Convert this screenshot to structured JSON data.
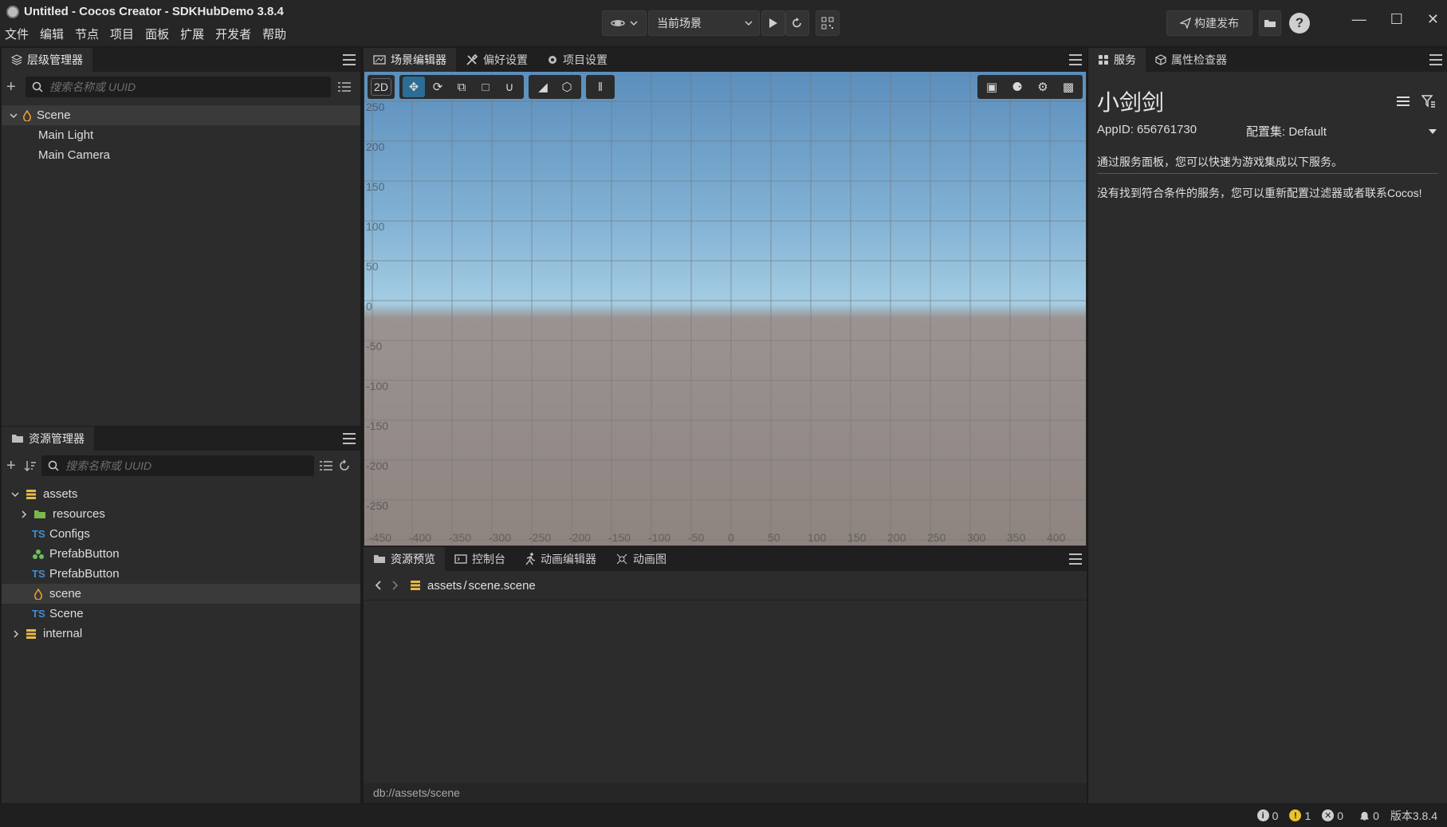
{
  "window": {
    "title": "Untitled - Cocos Creator - SDKHubDemo 3.8.4",
    "menus": [
      "文件",
      "编辑",
      "节点",
      "项目",
      "面板",
      "扩展",
      "开发者",
      "帮助"
    ],
    "scene_select": "当前场景",
    "build_label": "构建发布",
    "help_label": "?"
  },
  "hierarchy": {
    "tab": "层级管理器",
    "search_placeholder": "搜索名称或 UUID",
    "nodes": [
      "Scene",
      "Main Light",
      "Main Camera"
    ]
  },
  "assets": {
    "tab": "资源管理器",
    "search_placeholder": "搜索名称或 UUID",
    "items": [
      {
        "label": "assets",
        "icon": "db-icon"
      },
      {
        "label": "resources",
        "icon": "folder-icon"
      },
      {
        "label": "Configs",
        "icon": "TS"
      },
      {
        "label": "PrefabButton",
        "icon": "prefab-icon"
      },
      {
        "label": "PrefabButton",
        "icon": "TS"
      },
      {
        "label": "scene",
        "icon": "scene-icon"
      },
      {
        "label": "Scene",
        "icon": "TS"
      },
      {
        "label": "internal",
        "icon": "db-icon"
      }
    ]
  },
  "scene_editor": {
    "tabs": [
      "场景编辑器",
      "偏好设置",
      "项目设置"
    ],
    "mode_2d": "2D",
    "y_ticks": [
      "250",
      "200",
      "150",
      "100",
      "50",
      "0",
      "-50",
      "-100",
      "-150",
      "-200",
      "-250"
    ],
    "x_ticks": [
      "-450",
      "-400",
      "-350",
      "-300",
      "-250",
      "-200",
      "-150",
      "-100",
      "-50",
      "0",
      "50",
      "100",
      "150",
      "200",
      "250",
      "300",
      "350",
      "400"
    ]
  },
  "preview": {
    "tabs": [
      "资源预览",
      "控制台",
      "动画编辑器",
      "动画图"
    ],
    "path_root": "assets",
    "path_sep": "/",
    "path_file": "scene.scene",
    "footer": "db://assets/scene"
  },
  "services": {
    "tabs": [
      "服务",
      "属性检查器"
    ],
    "name": "小剑剑",
    "appid": "AppID: 656761730",
    "config": "配置集: Default",
    "intro": "通过服务面板，您可以快速为游戏集成以下服务。",
    "empty": "没有找到符合条件的服务，您可以重新配置过滤器或者联系Cocos!"
  },
  "status": {
    "info_count": "0",
    "warn_count": "1",
    "error_count": "0",
    "notify_count": "0",
    "version": "版本3.8.4"
  },
  "colors": {
    "accent": "#2a6d96",
    "ts": "#3d8ed8",
    "warn": "#e8c22f"
  }
}
